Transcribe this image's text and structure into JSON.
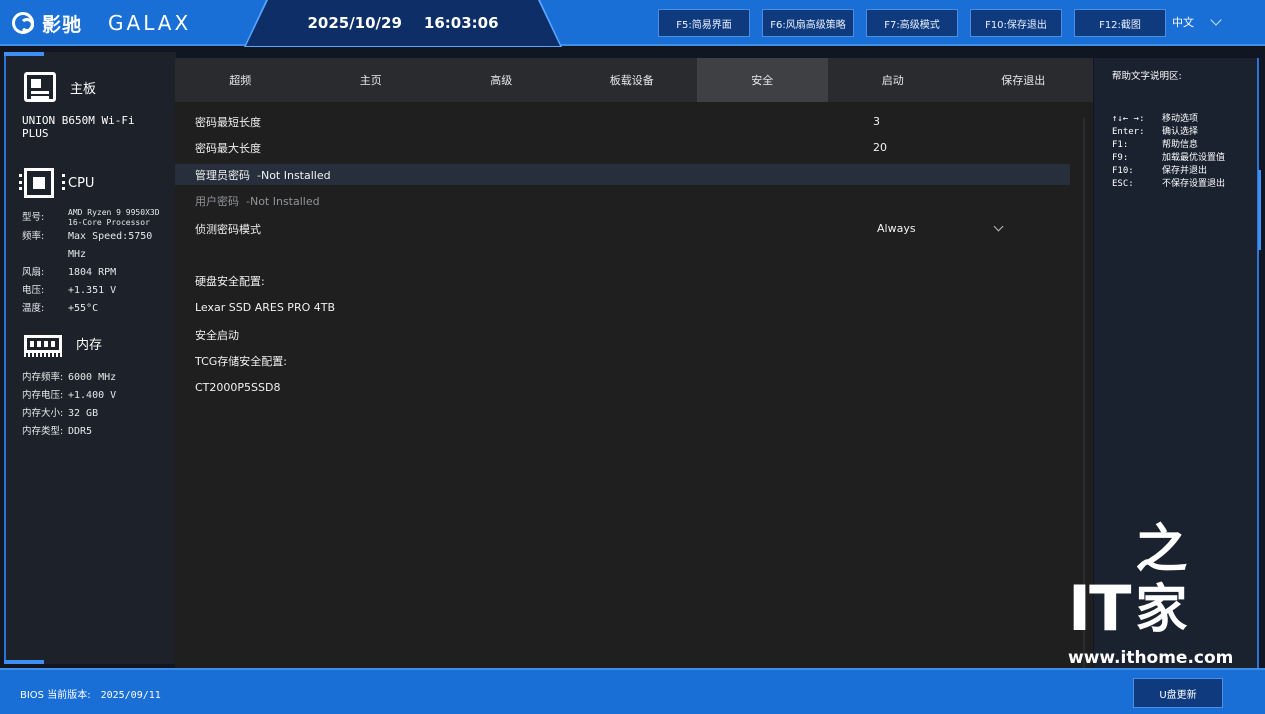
{
  "header": {
    "brand_cn": "影驰",
    "brand_en": "GALAX",
    "date": "2025/10/29",
    "time": "16:03:06",
    "fkeys": [
      {
        "label": "F5:简易界面"
      },
      {
        "label": "F6:风扇高级策略"
      },
      {
        "label": "F7:高级模式"
      },
      {
        "label": "F10:保存退出"
      },
      {
        "label": "F12:截图"
      }
    ],
    "language": "中文"
  },
  "sidebar": {
    "board": {
      "title": "主板",
      "name": "UNION B650M Wi-Fi PLUS"
    },
    "cpu": {
      "title": "CPU",
      "rows": [
        {
          "key": "型号:",
          "value": "AMD Ryzen 9 9950X3D 16-Core Processor"
        },
        {
          "key": "频率:",
          "value": "Max Speed:5750 MHz"
        },
        {
          "key": "风扇:",
          "value": "1804 RPM"
        },
        {
          "key": "电压:",
          "value": "+1.351 V"
        },
        {
          "key": "温度:",
          "value": "+55°C"
        }
      ]
    },
    "memory": {
      "title": "内存",
      "rows": [
        {
          "key": "内存频率:",
          "value": "6000 MHz"
        },
        {
          "key": "内存电压:",
          "value": "+1.400 V"
        },
        {
          "key": "内存大小:",
          "value": "32 GB"
        },
        {
          "key": "内存类型:",
          "value": "DDR5"
        }
      ]
    }
  },
  "tabs": [
    {
      "label": "超频"
    },
    {
      "label": "主页"
    },
    {
      "label": "高级"
    },
    {
      "label": "板载设备"
    },
    {
      "label": "安全",
      "active": true
    },
    {
      "label": "启动"
    },
    {
      "label": "保存退出"
    }
  ],
  "settings": {
    "min_len": {
      "label": "密码最短长度",
      "value": "3"
    },
    "max_len": {
      "label": "密码最大长度",
      "value": "20"
    },
    "admin_pw": {
      "label": "管理员密码  -Not Installed"
    },
    "user_pw": {
      "label": "用户密码  -Not Installed"
    },
    "detect_mode": {
      "label": "侦测密码模式",
      "value": "Always"
    },
    "hdd_security": {
      "label": "硬盘安全配置:"
    },
    "hdd_device": {
      "label": "Lexar SSD ARES PRO 4TB"
    },
    "secure_boot": {
      "label": "安全启动"
    },
    "tcg": {
      "label": "TCG存储安全配置:"
    },
    "tcg_device": {
      "label": "CT2000P5SSD8"
    }
  },
  "help": {
    "title": "帮助文字说明区:",
    "items": [
      {
        "key": "↑↓← →:",
        "desc": "移动选项"
      },
      {
        "key": "Enter:",
        "desc": "确认选择"
      },
      {
        "key": "F1:",
        "desc": "帮助信息"
      },
      {
        "key": "F9:",
        "desc": "加载最优设置值"
      },
      {
        "key": "F10:",
        "desc": "保存并退出"
      },
      {
        "key": "ESC:",
        "desc": "不保存设置退出"
      }
    ]
  },
  "watermark": {
    "it": "IT",
    "cn": "之家",
    "url": "www.ithome.com"
  },
  "footer": {
    "bios_label": "BIOS 当前版本:",
    "bios_date": "2025/09/11",
    "usb_update": "U盘更新"
  },
  "colors": {
    "accent": "#1a6fd6",
    "panel": "#1f1f1f",
    "active_tab": "#3f4043"
  }
}
